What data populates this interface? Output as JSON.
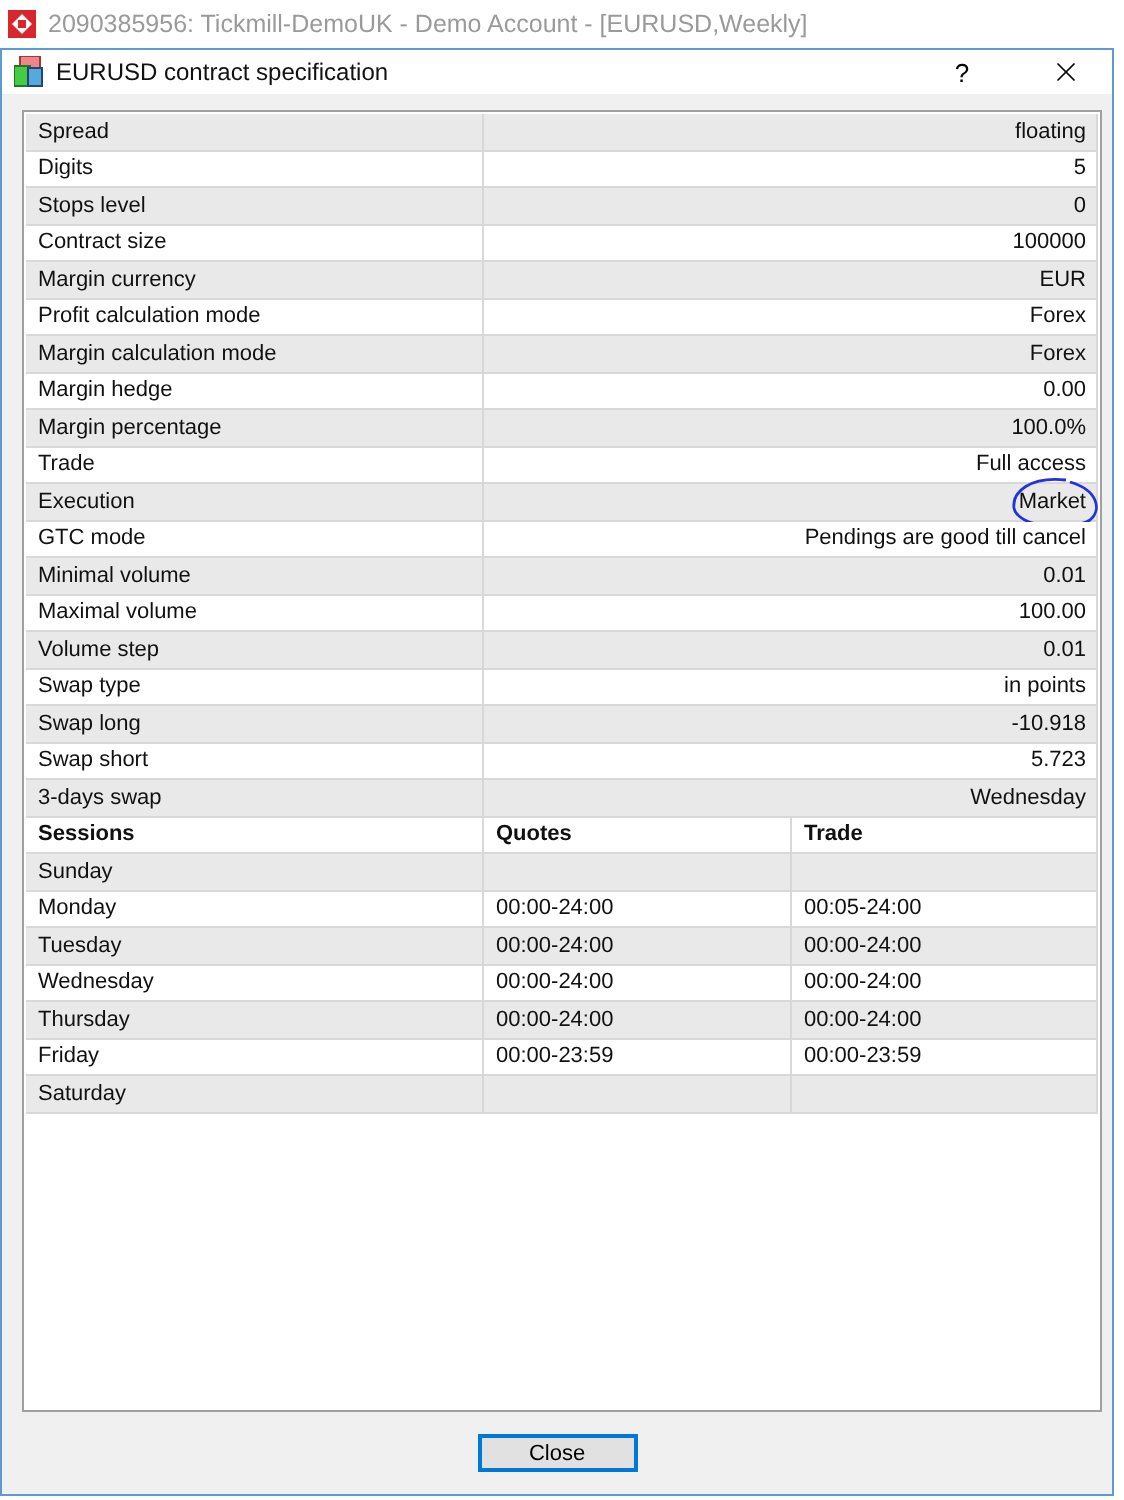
{
  "app_title": "2090385956: Tickmill-DemoUK - Demo Account - [EURUSD,Weekly]",
  "dialog": {
    "title": "EURUSD contract specification",
    "help": "?"
  },
  "spec_rows": [
    {
      "name": "Spread",
      "value": "floating",
      "circled": false
    },
    {
      "name": "Digits",
      "value": "5",
      "circled": false
    },
    {
      "name": "Stops level",
      "value": "0",
      "circled": false
    },
    {
      "name": "Contract size",
      "value": "100000",
      "circled": false
    },
    {
      "name": "Margin currency",
      "value": "EUR",
      "circled": false
    },
    {
      "name": "Profit calculation mode",
      "value": "Forex",
      "circled": false
    },
    {
      "name": "Margin calculation mode",
      "value": "Forex",
      "circled": false
    },
    {
      "name": "Margin hedge",
      "value": "0.00",
      "circled": false
    },
    {
      "name": "Margin percentage",
      "value": "100.0%",
      "circled": false
    },
    {
      "name": "Trade",
      "value": "Full access",
      "circled": false
    },
    {
      "name": "Execution",
      "value": "Market",
      "circled": true
    },
    {
      "name": "GTC mode",
      "value": "Pendings are good till cancel",
      "circled": false
    },
    {
      "name": "Minimal volume",
      "value": "0.01",
      "circled": false
    },
    {
      "name": "Maximal volume",
      "value": "100.00",
      "circled": false
    },
    {
      "name": "Volume step",
      "value": "0.01",
      "circled": false
    },
    {
      "name": "Swap type",
      "value": "in points",
      "circled": false
    },
    {
      "name": "Swap long",
      "value": "-10.918",
      "circled": false
    },
    {
      "name": "Swap short",
      "value": "5.723",
      "circled": false
    },
    {
      "name": "3-days swap",
      "value": "Wednesday",
      "circled": false
    }
  ],
  "sessions": {
    "columns": [
      "Sessions",
      "Quotes",
      "Trade"
    ],
    "rows": [
      {
        "day": "Sunday"
      },
      {
        "day": "Monday",
        "quotes": "00:00-24:00",
        "trade": "00:05-24:00"
      },
      {
        "day": "Tuesday",
        "quotes": "00:00-24:00",
        "trade": "00:00-24:00"
      },
      {
        "day": "Wednesday",
        "quotes": "00:00-24:00",
        "trade": "00:00-24:00"
      },
      {
        "day": "Thursday",
        "quotes": "00:00-24:00",
        "trade": "00:00-24:00"
      },
      {
        "day": "Friday",
        "quotes": "00:00-23:59",
        "trade": "00:00-23:59"
      },
      {
        "day": "Saturday"
      }
    ]
  },
  "buttons": [
    "Close"
  ]
}
